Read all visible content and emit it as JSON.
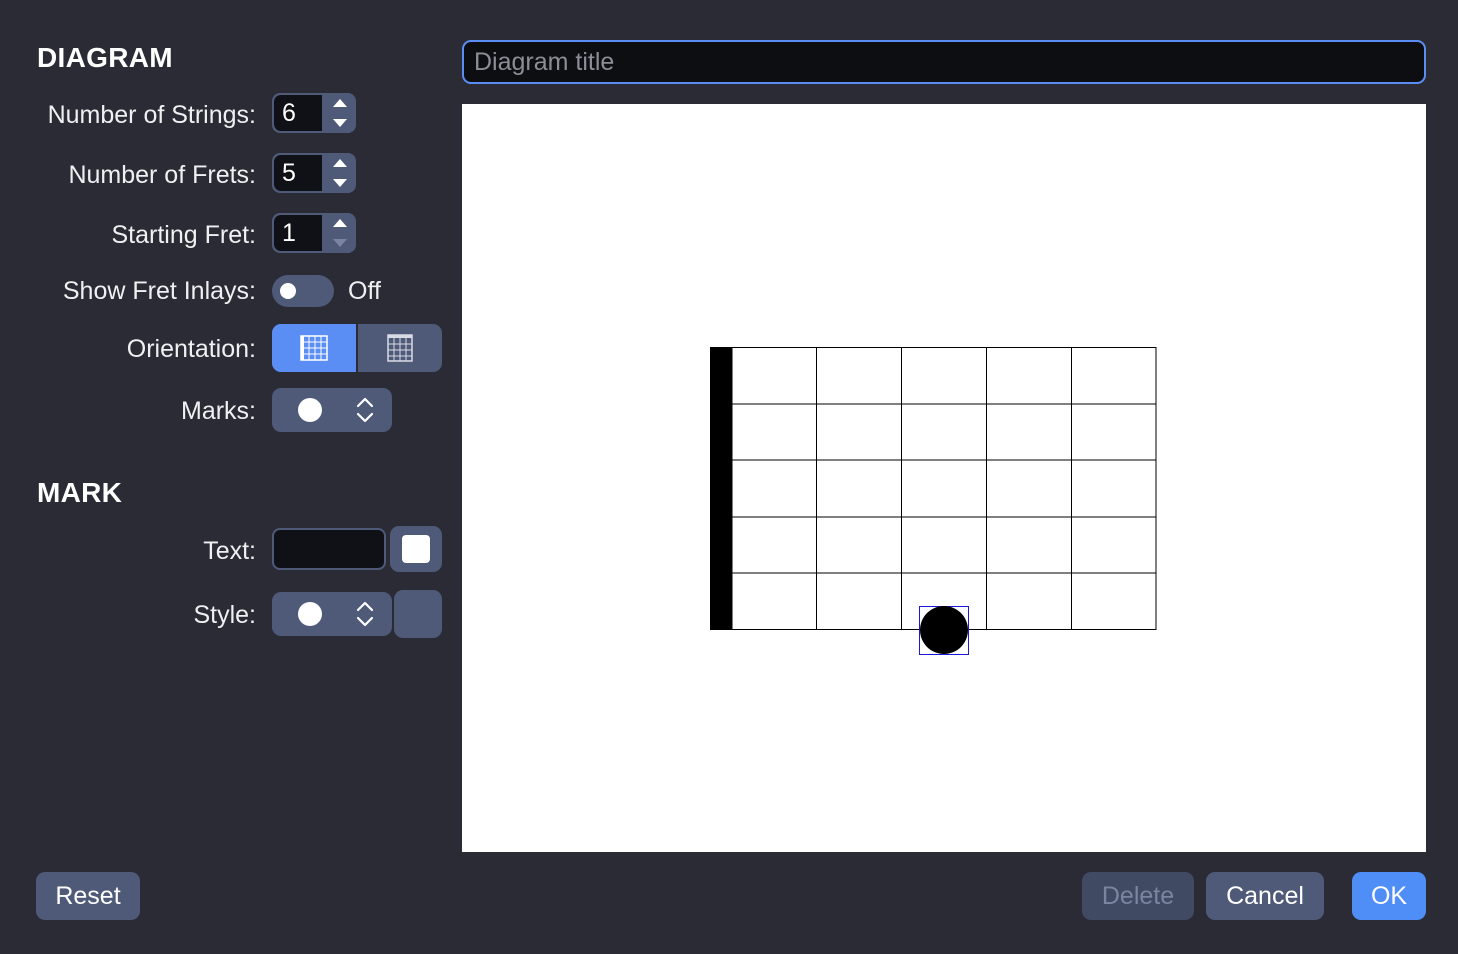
{
  "diagram_section": {
    "title": "DIAGRAM",
    "strings_label": "Number of Strings:",
    "strings_value": "6",
    "frets_label": "Number of Frets:",
    "frets_value": "5",
    "starting_fret_label": "Starting Fret:",
    "starting_fret_value": "1",
    "inlays_label": "Show Fret Inlays:",
    "inlays_state": "Off",
    "orientation_label": "Orientation:",
    "orientation_selected": "horizontal",
    "marks_label": "Marks:",
    "marks_value": "circle"
  },
  "mark_section": {
    "title": "MARK",
    "text_label": "Text:",
    "text_value": "",
    "text_color": "#ffffff",
    "style_label": "Style:",
    "style_value": "circle"
  },
  "title_field": {
    "placeholder": "Diagram title",
    "value": ""
  },
  "fretboard": {
    "strings": 6,
    "frets": 5,
    "marks": [
      {
        "string": 6,
        "fret": 3,
        "selected": true
      }
    ]
  },
  "buttons": {
    "reset": "Reset",
    "delete": "Delete",
    "cancel": "Cancel",
    "ok": "OK"
  },
  "colors": {
    "background": "#2a2b34",
    "control": "#4e5a78",
    "accent": "#5b8ef5",
    "selection": "#1a1ad6"
  }
}
